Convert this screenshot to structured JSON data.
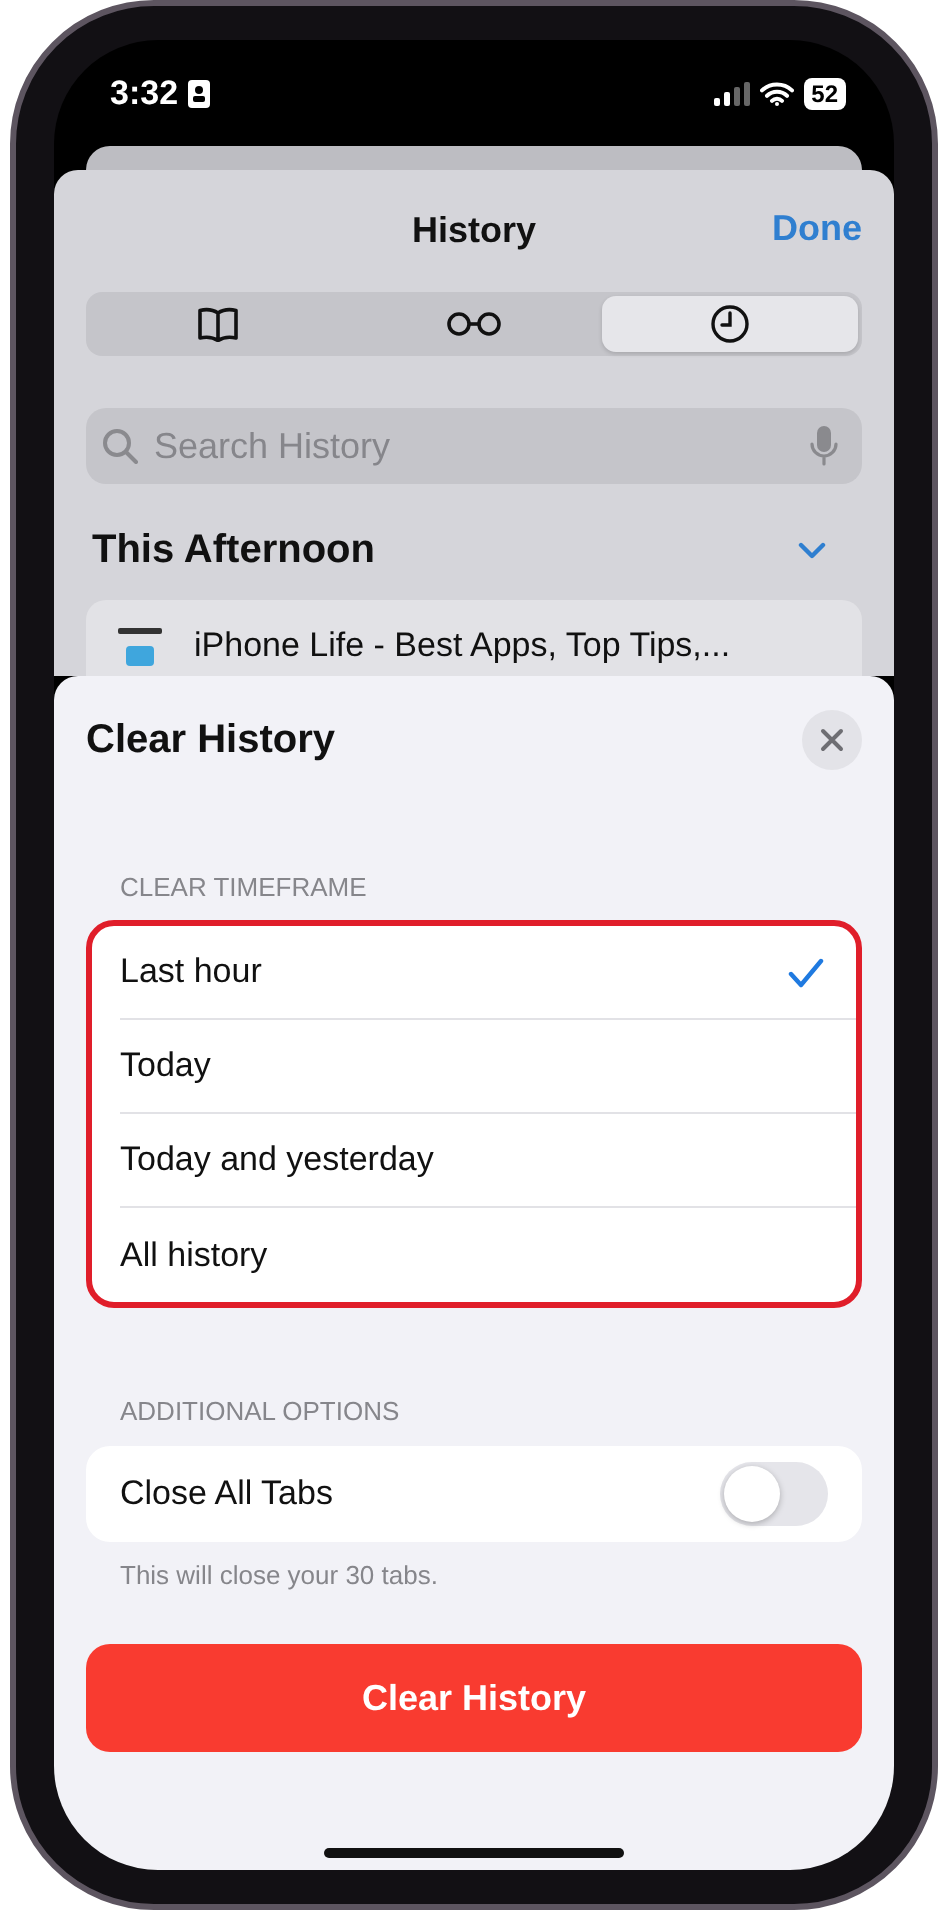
{
  "status_bar": {
    "time": "3:32",
    "battery": "52"
  },
  "history_sheet": {
    "title": "History",
    "done": "Done",
    "segments": [
      {
        "kind": "bookmarks",
        "selected": false
      },
      {
        "kind": "reading-list",
        "selected": false
      },
      {
        "kind": "history",
        "selected": true
      }
    ],
    "search": {
      "placeholder": "Search History"
    },
    "section": {
      "title": "This Afternoon",
      "expanded": true
    },
    "rows": [
      {
        "title": "iPhone Life - Best Apps, Top Tips,..."
      }
    ]
  },
  "clear_sheet": {
    "title": "Clear History",
    "timeframe_label": "CLEAR TIMEFRAME",
    "timeframes": [
      {
        "label": "Last hour",
        "selected": true
      },
      {
        "label": "Today",
        "selected": false
      },
      {
        "label": "Today and yesterday",
        "selected": false
      },
      {
        "label": "All history",
        "selected": false
      }
    ],
    "options_label": "ADDITIONAL OPTIONS",
    "options": [
      {
        "label": "Close All Tabs",
        "on": false
      }
    ],
    "footnote": "This will close your 30 tabs.",
    "button": "Clear History"
  }
}
